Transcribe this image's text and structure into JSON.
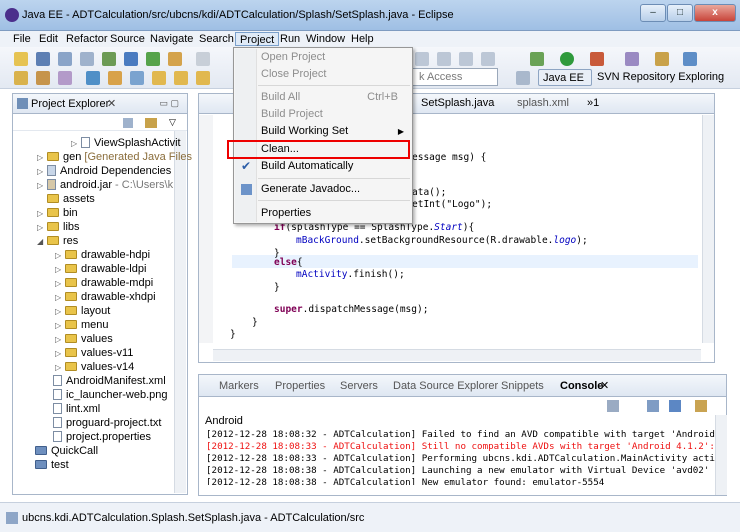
{
  "window": {
    "title": "Java EE - ADTCalculation/src/ubcns/kdi/ADTCalculation/Splash/SetSplash.java - Eclipse",
    "min": "–",
    "max": "□",
    "close": "x"
  },
  "menubar": [
    "File",
    "Edit",
    "Refactor",
    "Source",
    "Navigate",
    "Search",
    "Project",
    "Run",
    "Window",
    "Help"
  ],
  "toolbar": {
    "quick_access": "k Access",
    "perspective_java": "Java EE",
    "perspective_svn": "SVN Repository Exploring"
  },
  "project_menu": {
    "items": [
      {
        "label": "Open Project",
        "enabled": false
      },
      {
        "label": "Close Project",
        "enabled": false
      },
      {
        "label": "Build All",
        "shortcut": "Ctrl+B",
        "enabled": false
      },
      {
        "label": "Build Project",
        "enabled": false
      },
      {
        "label": "Build Working Set",
        "enabled": true,
        "submenu": "▶"
      },
      {
        "label": "Clean...",
        "enabled": true
      },
      {
        "label": "Build Automatically",
        "enabled": true,
        "checked": "✔"
      },
      {
        "label": "Generate Javadoc...",
        "enabled": true
      },
      {
        "label": "Properties",
        "enabled": true
      }
    ]
  },
  "project_explorer": {
    "title": "Project Explorer",
    "items": [
      {
        "label": "ViewSplashActivit",
        "type": "file"
      },
      {
        "label": "gen",
        "extra": "[Generated Java Files",
        "type": "folder"
      },
      {
        "label": "Android Dependencies",
        "type": "lib"
      },
      {
        "label": "android.jar",
        "extra": "- C:\\Users\\k",
        "type": "lib"
      },
      {
        "label": "assets",
        "type": "folder"
      },
      {
        "label": "bin",
        "type": "folder"
      },
      {
        "label": "libs",
        "type": "folder"
      },
      {
        "label": "res",
        "type": "folder"
      },
      {
        "label": "drawable-hdpi",
        "type": "folder"
      },
      {
        "label": "drawable-ldpi",
        "type": "folder"
      },
      {
        "label": "drawable-mdpi",
        "type": "folder"
      },
      {
        "label": "drawable-xhdpi",
        "type": "folder"
      },
      {
        "label": "layout",
        "type": "folder"
      },
      {
        "label": "menu",
        "type": "folder"
      },
      {
        "label": "values",
        "type": "folder"
      },
      {
        "label": "values-v11",
        "type": "folder"
      },
      {
        "label": "values-v14",
        "type": "folder"
      },
      {
        "label": "AndroidManifest.xml",
        "type": "file"
      },
      {
        "label": "ic_launcher-web.png",
        "type": "file"
      },
      {
        "label": "lint.xml",
        "type": "file"
      },
      {
        "label": "proguard-project.txt",
        "type": "file"
      },
      {
        "label": "project.properties",
        "type": "file"
      },
      {
        "label": "QuickCall",
        "type": "project"
      },
      {
        "label": "test",
        "type": "project"
      }
    ]
  },
  "editor": {
    "tabs": [
      "SetSplash.java",
      "splash.xml",
      "»1"
    ],
    "code": [
      "essage msg) {",
      "ata();",
      "etInt(\"Logo\");",
      "if(splashType == SplashType.Start){",
      "mBackGround.setBackgroundResource(R.drawable.logo);",
      "}",
      "else{",
      "mActivity.finish();",
      "}",
      "super.dispatchMessage(msg);",
      "}",
      "}"
    ]
  },
  "bottom_panel": {
    "tabs": [
      "Markers",
      "Properties",
      "Servers",
      "Data Source Explorer",
      "Snippets",
      "Console"
    ],
    "console_title": "Android",
    "console_lines": [
      {
        "text": "[2012-12-28 18:08:32 - ADTCalculation] Failed to find an AVD compatible with target 'Android",
        "error": false
      },
      {
        "text": "[2012-12-28 18:08:33 - ADTCalculation] Still no compatible AVDs with target 'Android 4.1.2':",
        "error": true
      },
      {
        "text": "[2012-12-28 18:08:33 - ADTCalculation] Performing ubcns.kdi.ADTCalculation.MainActivity acti",
        "error": false
      },
      {
        "text": "[2012-12-28 18:08:38 - ADTCalculation] Launching a new emulator with Virtual Device 'avd02'",
        "error": false
      },
      {
        "text": "[2012-12-28 18:08:38 - ADTCalculation] New emulator found: emulator-5554",
        "error": false
      }
    ]
  },
  "status": {
    "text": "ubcns.kdi.ADTCalculation.Splash.SetSplash.java - ADTCalculation/src"
  }
}
